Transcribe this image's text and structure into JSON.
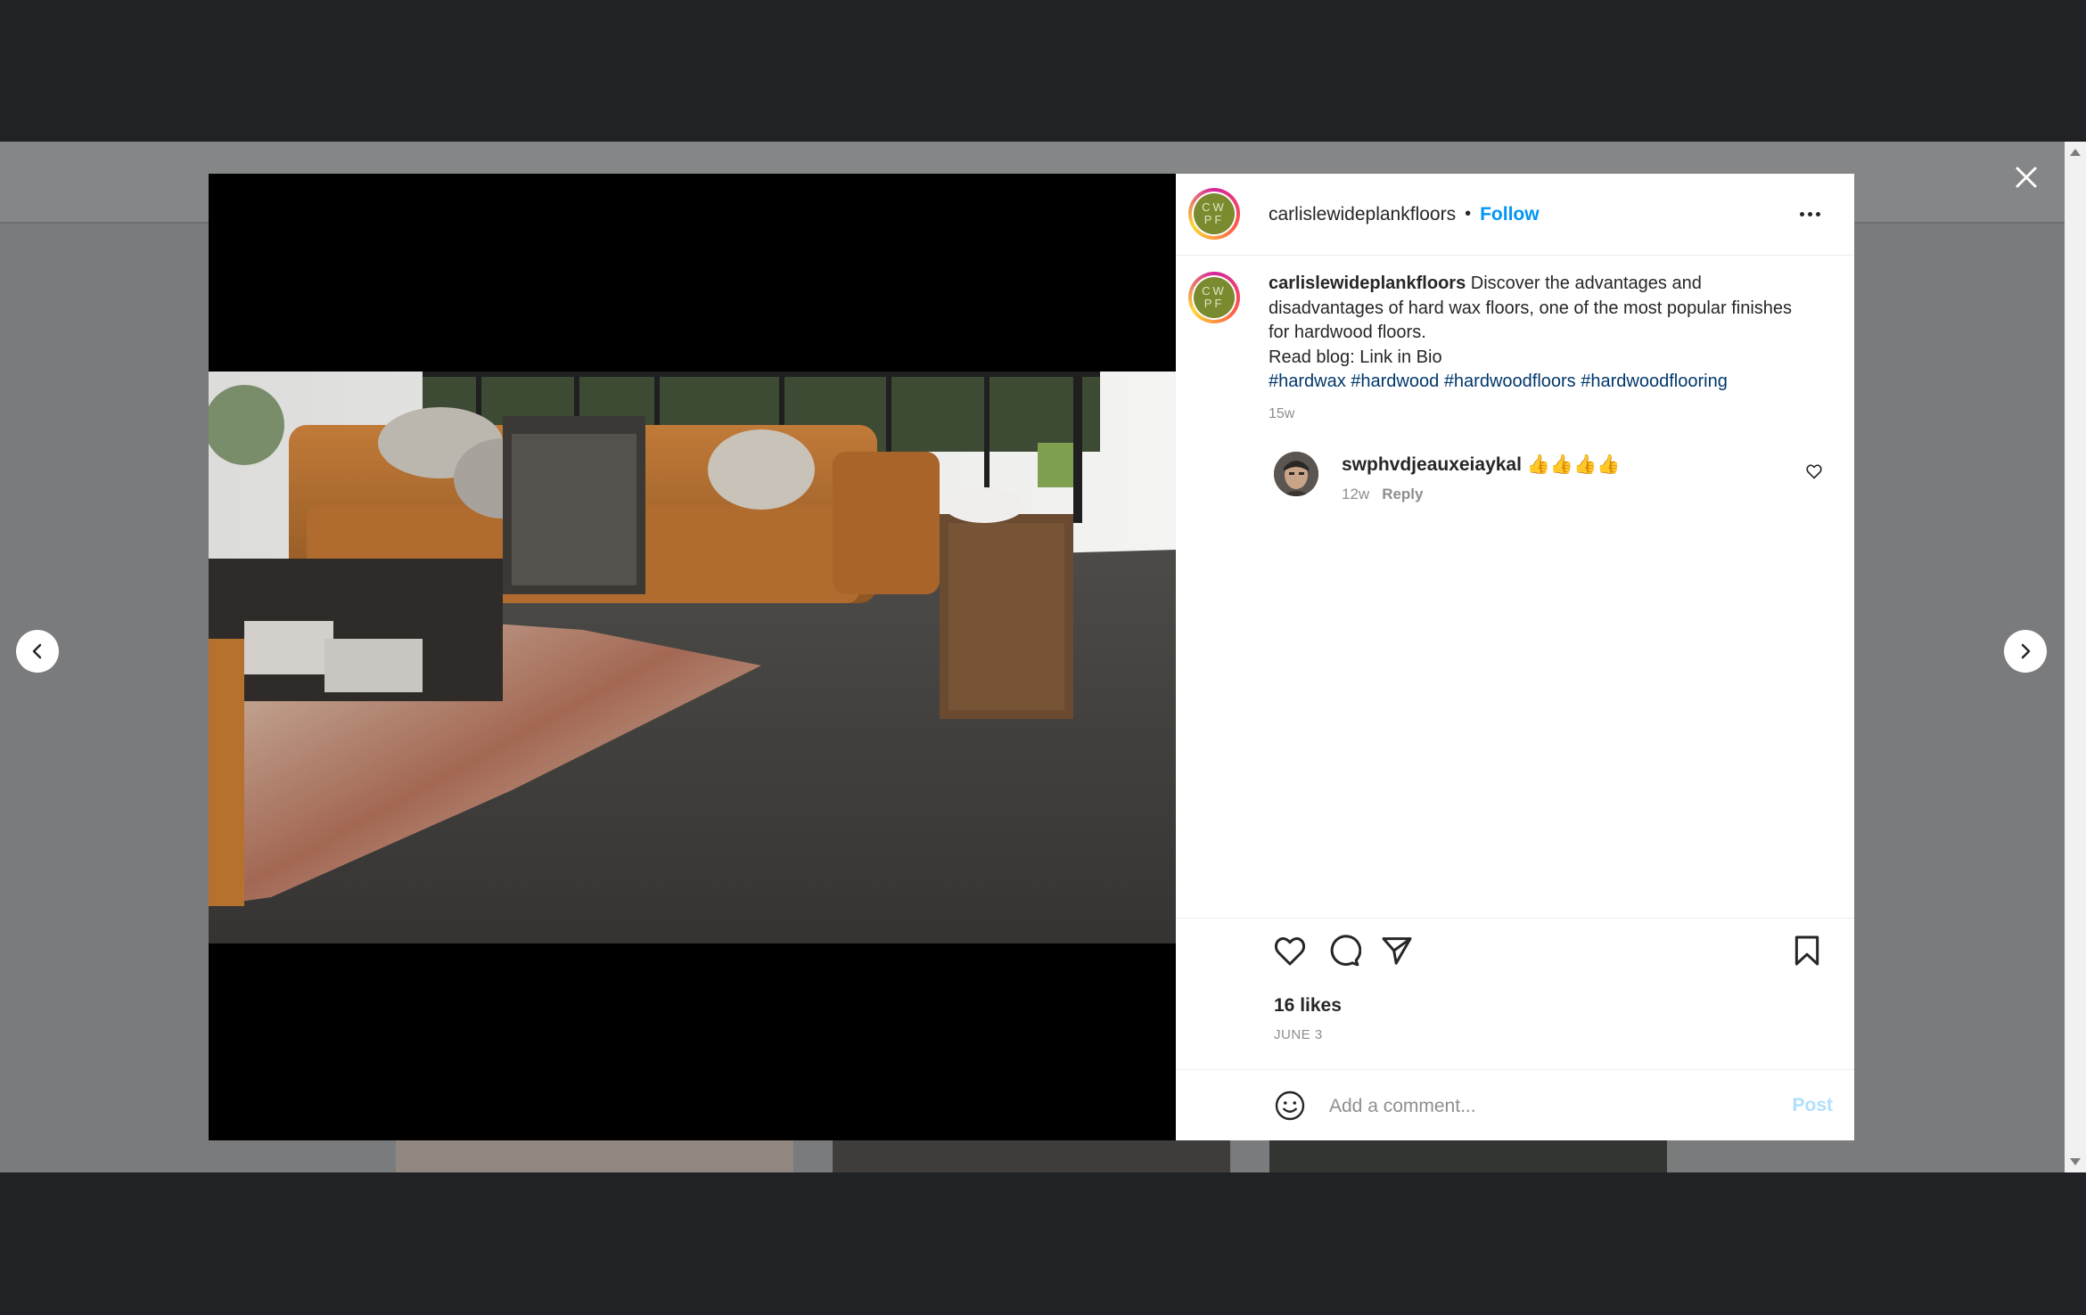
{
  "post": {
    "username": "carlislewideplankfloors",
    "separator": "•",
    "follow_label": "Follow",
    "avatar_initials": [
      "CW",
      "PF"
    ],
    "caption": {
      "username": "carlislewideplankfloors",
      "text_1": " Discover the advantages and disadvantages of hard wax floors, one of the most popular finishes for hardwood floors.",
      "text_2": "Read blog: Link in Bio",
      "hashtags": [
        "#hardwax",
        "#hardwood",
        "#hardwoodfloors",
        "#hardwoodflooring"
      ],
      "time": "15w"
    },
    "comments": [
      {
        "username": "swphvdjeauxeiaykal",
        "text": " 👍👍👍👍",
        "time": "12w",
        "reply_label": "Reply"
      }
    ],
    "likes": "16 likes",
    "date": "JUNE 3",
    "add_comment_placeholder": "Add a comment...",
    "post_label": "Post"
  },
  "colors": {
    "follow": "#0095f6",
    "hashtag": "#00376b",
    "post_disabled": "#b2dffc",
    "overlay": "#7a7b7c"
  },
  "icons": {
    "close": "close-icon",
    "prev": "chevron-left-icon",
    "next": "chevron-right-icon",
    "more": "more-horizontal-icon",
    "like": "heart-icon",
    "comment": "comment-icon",
    "share": "share-icon",
    "save": "bookmark-icon",
    "emoji": "emoji-icon"
  }
}
